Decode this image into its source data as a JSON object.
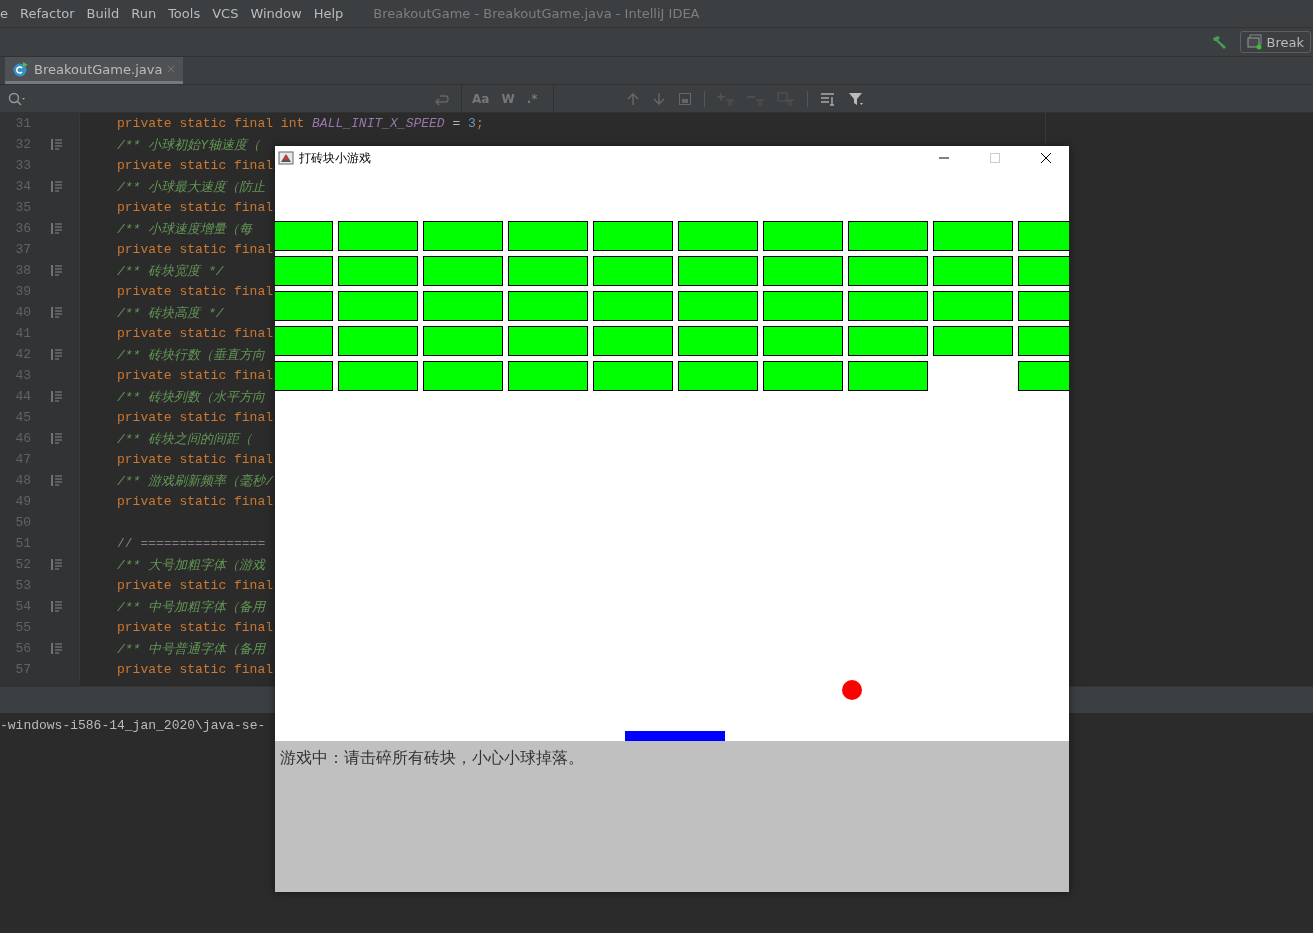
{
  "menu": {
    "items": [
      "e",
      "Refactor",
      "Build",
      "Run",
      "Tools",
      "VCS",
      "Window",
      "Help"
    ],
    "title": "BreakoutGame - BreakoutGame.java - IntelliJ IDEA"
  },
  "toolbar": {
    "run_config": "Break"
  },
  "editor_tabs": [
    {
      "label": "BreakoutGame.java",
      "selected": true
    }
  ],
  "search_bar": {
    "options": [
      "Aa",
      "W",
      ".*"
    ]
  },
  "code_lines": [
    {
      "number": "31",
      "doc_toggle": false,
      "tokens": [
        {
          "t": "private static final int ",
          "kind": "kw"
        },
        {
          "t": "BALL_INIT_X_SPEED",
          "kind": "const"
        },
        {
          "t": " = ",
          "kind": "op"
        },
        {
          "t": "3",
          "kind": "num"
        },
        {
          "t": ";",
          "kind": "kw"
        }
      ]
    },
    {
      "number": "32",
      "doc_toggle": true,
      "tokens": [
        {
          "t": "/** 小球初始Y轴速度（",
          "kind": "comment"
        }
      ]
    },
    {
      "number": "33",
      "doc_toggle": false,
      "tokens": [
        {
          "t": "private static final",
          "kind": "kw"
        }
      ]
    },
    {
      "number": "34",
      "doc_toggle": true,
      "tokens": [
        {
          "t": "/** 小球最大速度（防止",
          "kind": "comment"
        }
      ]
    },
    {
      "number": "35",
      "doc_toggle": false,
      "tokens": [
        {
          "t": "private static final",
          "kind": "kw"
        }
      ]
    },
    {
      "number": "36",
      "doc_toggle": true,
      "tokens": [
        {
          "t": "/** 小球速度增量（每",
          "kind": "comment"
        }
      ]
    },
    {
      "number": "37",
      "doc_toggle": false,
      "tokens": [
        {
          "t": "private static final",
          "kind": "kw"
        }
      ]
    },
    {
      "number": "38",
      "doc_toggle": true,
      "tokens": [
        {
          "t": "/** 砖块宽度 */",
          "kind": "comment"
        }
      ]
    },
    {
      "number": "39",
      "doc_toggle": false,
      "tokens": [
        {
          "t": "private static final",
          "kind": "kw"
        }
      ]
    },
    {
      "number": "40",
      "doc_toggle": true,
      "tokens": [
        {
          "t": "/** 砖块高度 */",
          "kind": "comment"
        }
      ]
    },
    {
      "number": "41",
      "doc_toggle": false,
      "tokens": [
        {
          "t": "private static final",
          "kind": "kw"
        }
      ]
    },
    {
      "number": "42",
      "doc_toggle": true,
      "tokens": [
        {
          "t": "/** 砖块行数（垂直方向",
          "kind": "comment"
        }
      ]
    },
    {
      "number": "43",
      "doc_toggle": false,
      "tokens": [
        {
          "t": "private static final",
          "kind": "kw"
        }
      ]
    },
    {
      "number": "44",
      "doc_toggle": true,
      "tokens": [
        {
          "t": "/** 砖块列数（水平方向",
          "kind": "comment"
        }
      ]
    },
    {
      "number": "45",
      "doc_toggle": false,
      "tokens": [
        {
          "t": "private static final",
          "kind": "kw"
        }
      ]
    },
    {
      "number": "46",
      "doc_toggle": true,
      "tokens": [
        {
          "t": "/** 砖块之间的间距（",
          "kind": "comment"
        }
      ]
    },
    {
      "number": "47",
      "doc_toggle": false,
      "tokens": [
        {
          "t": "private static final",
          "kind": "kw"
        }
      ]
    },
    {
      "number": "48",
      "doc_toggle": true,
      "tokens": [
        {
          "t": "/** 游戏刷新频率（毫秒/",
          "kind": "comment"
        }
      ]
    },
    {
      "number": "49",
      "doc_toggle": false,
      "tokens": [
        {
          "t": "private static final",
          "kind": "kw"
        }
      ]
    },
    {
      "number": "50",
      "doc_toggle": false
    },
    {
      "number": "51",
      "doc_toggle": false,
      "tokens": [
        {
          "t": "// ================",
          "kind": "comment_plain"
        }
      ]
    },
    {
      "number": "52",
      "doc_toggle": true,
      "tokens": [
        {
          "t": "/** 大号加粗字体（游戏",
          "kind": "comment"
        }
      ]
    },
    {
      "number": "53",
      "doc_toggle": false,
      "tokens": [
        {
          "t": "private static final",
          "kind": "kw"
        }
      ]
    },
    {
      "number": "54",
      "doc_toggle": true,
      "tokens": [
        {
          "t": "/** 中号加粗字体（备用",
          "kind": "comment"
        }
      ]
    },
    {
      "number": "55",
      "doc_toggle": false,
      "tokens": [
        {
          "t": "private static final",
          "kind": "kw"
        }
      ]
    },
    {
      "number": "56",
      "doc_toggle": true,
      "tokens": [
        {
          "t": "/** 中号普通字体（备用",
          "kind": "comment"
        }
      ]
    },
    {
      "number": "57",
      "doc_toggle": false,
      "tokens": [
        {
          "t": "private static final",
          "kind": "kw"
        }
      ]
    }
  ],
  "console": {
    "line": "-windows-i586-14_jan_2020\\java-se-"
  },
  "game_window": {
    "title": "打砖块小游戏",
    "brick_rows": [
      [
        true,
        true,
        true,
        true,
        true,
        true,
        true,
        true,
        true,
        true
      ],
      [
        true,
        true,
        true,
        true,
        true,
        true,
        true,
        true,
        true,
        true
      ],
      [
        true,
        true,
        true,
        true,
        true,
        true,
        true,
        true,
        true,
        true
      ],
      [
        true,
        true,
        true,
        true,
        true,
        true,
        true,
        true,
        true,
        true
      ],
      [
        true,
        true,
        true,
        true,
        true,
        true,
        true,
        true,
        false,
        true
      ]
    ],
    "status": "游戏中：请击碎所有砖块，小心小球掉落。"
  }
}
